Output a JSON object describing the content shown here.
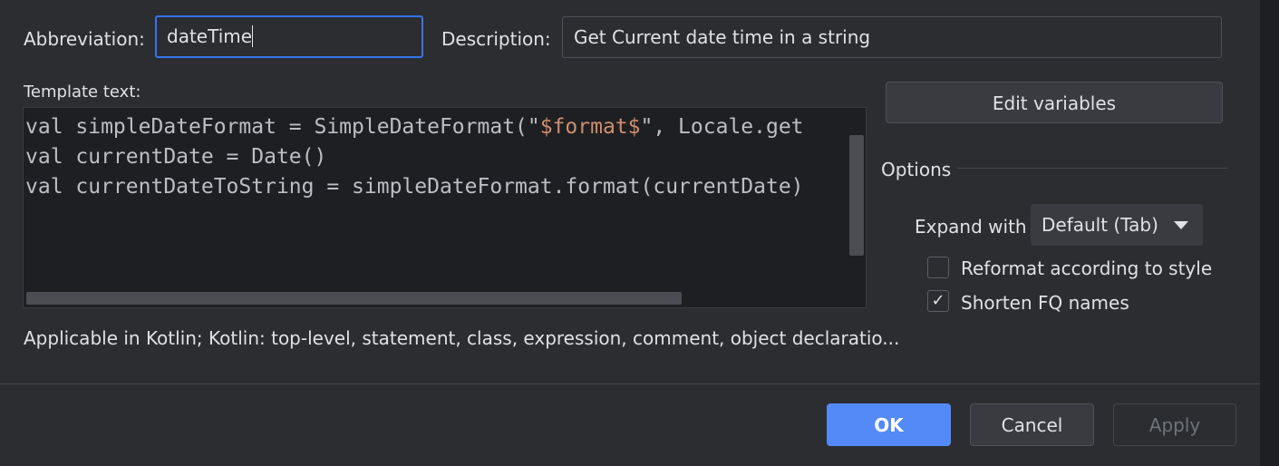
{
  "abbreviation": {
    "label": "Abbreviation:",
    "value": "dateTime"
  },
  "description": {
    "label": "Description:",
    "value": "Get Current date time in a string"
  },
  "template": {
    "label": "Template text:",
    "line1_a": "val simpleDateFormat = SimpleDateFormat(\"",
    "line1_var": "$format$",
    "line1_b": "\", Locale.get",
    "line2": "val currentDate = Date()",
    "line3": "val currentDateToString = simpleDateFormat.format(currentDate)"
  },
  "edit_variables_label": "Edit variables",
  "options": {
    "title": "Options",
    "expand_with_label": "Expand with",
    "expand_with_value": "Default (Tab)",
    "reformat_label": "Reformat according to style",
    "reformat_checked": false,
    "shorten_label": "Shorten FQ names",
    "shorten_checked": true,
    "check_glyph": "✓"
  },
  "applicable_text": "Applicable in Kotlin; Kotlin: top-level, statement, class, expression, comment, object declaratio...",
  "buttons": {
    "ok": "OK",
    "cancel": "Cancel",
    "apply": "Apply"
  }
}
